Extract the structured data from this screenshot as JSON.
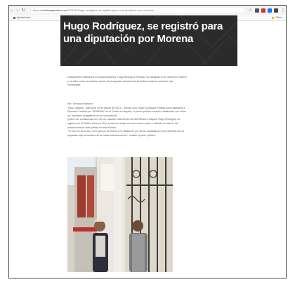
{
  "browser": {
    "url_host": "noticiasejecutivo.mx",
    "url_prefix": "https://",
    "url_path": "/2021/03/hugo-rodriguez-se-registro-para-una-diputacion-por-morena/",
    "bookmarks_left": "Aplicaciones",
    "bookmarks_right": "Otros"
  },
  "article": {
    "title": "Hugo Rodríguez, se registró para una diputación por Morena",
    "lead": "Nuevamente reiteramos el posicionamiento, Hugo Rodríguez Partida, ha trabajado en el Gobierno Federal y se sabe como la tradición social, lleva impulsar acciones de beneficio hacia los sectores más vulnerables.",
    "byline": "Por: Verónica Ramírez",
    "dateline": "Tepic, Nayarit.– Miércoles 03 de marzo de 2021.– Siendo 8:00 Hugo Rodríguez Partida como aspirante a Diputado Federal por \"MORENA\" en el Cuarto en Nayarit, el primer político cumplió cabalmente con todos los requisitos obligatorios en la convocatoria.",
    "para2": "Quiero ser considerado uno de los cuadros más fuertes de MORENA en Nayarit, Hugo Rodríguez se registró por el Distrito Número 03 y cuenta con todas sus derechos a salvo e iniciado su vida en las fundaciones de este partido en este Estado.",
    "para3": "\"Yo creo en la lucha y es lo que yo he hecho y he dejado en pro de los ciudadanos y los intereses de los nayaritas bajo la bandera de la cuarta transformación\", resaltó el joven político."
  },
  "colors": {
    "hero_bg": "#2a2a2a",
    "toolbar_bg": "#f1f3f4",
    "ext_red": "#d93025",
    "ext_blue": "#1a73e8",
    "ext_yellow": "#f2b705"
  }
}
